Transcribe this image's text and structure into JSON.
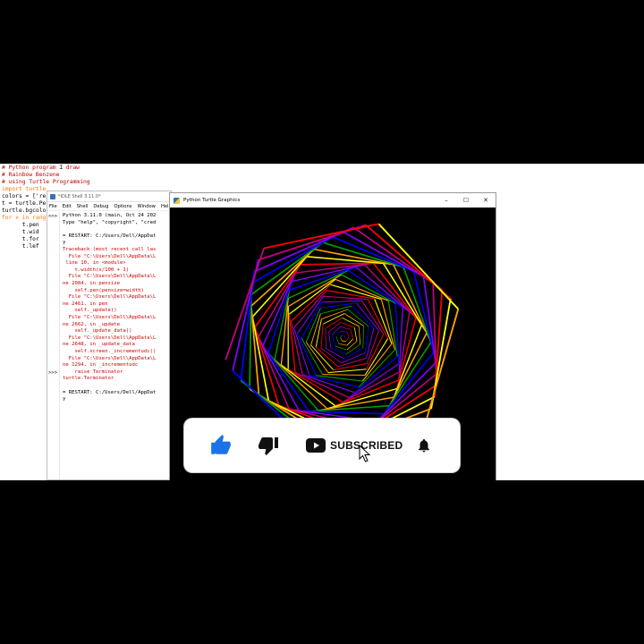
{
  "editor": {
    "lines": [
      {
        "text": "# Python program ",
        "tail": " draw",
        "cls": "c-comment"
      },
      {
        "text": "# Rainbow Benzene",
        "cls": "c-comment"
      },
      {
        "text": "# using Turtle Programming",
        "cls": "c-comment"
      },
      {
        "text": "import turtle",
        "cls": "c-kw"
      },
      {
        "text": "colors = ['re",
        "cls": ""
      },
      {
        "text": "t = turtle.Pe",
        "cls": ""
      },
      {
        "text": "turtle.bgcolo",
        "cls": ""
      },
      {
        "text": "for x in rang",
        "cls": "c-kw"
      },
      {
        "text": "      t.pen",
        "cls": ""
      },
      {
        "text": "      t.wid",
        "cls": ""
      },
      {
        "text": "      t.for",
        "cls": ""
      },
      {
        "text": "      t.lef",
        "cls": ""
      }
    ]
  },
  "idle": {
    "title": "*IDLE Shell 3.11.0*",
    "menus": [
      "File",
      "Edit",
      "Shell",
      "Debug",
      "Options",
      "Window",
      "Help"
    ],
    "prompts": [
      ">>>",
      ">>>"
    ],
    "lines": [
      {
        "text": "Python 3.11.0 (main, Oct 24 202",
        "cls": ""
      },
      {
        "text": "Type \"help\", \"copyright\", \"cred",
        "cls": ""
      },
      {
        "text": "",
        "cls": ""
      },
      {
        "text": "= RESTART: C:/Users/Dell/AppDat",
        "cls": ""
      },
      {
        "text": "y",
        "cls": ""
      },
      {
        "text": "Traceback (most recent call las",
        "cls": "s-red"
      },
      {
        "text": "  File \"C:\\Users\\Dell\\AppData\\L",
        "cls": "s-red"
      },
      {
        "text": " line 10, in <module>",
        "cls": "s-red"
      },
      {
        "text": "    t.width(x/100 + 1)",
        "cls": "s-red"
      },
      {
        "text": "  File \"C:\\Users\\Dell\\AppData\\L",
        "cls": "s-red"
      },
      {
        "text": "ne 2084, in pensize",
        "cls": "s-red"
      },
      {
        "text": "    self.pen(pensize=width)",
        "cls": "s-red"
      },
      {
        "text": "  File \"C:\\Users\\Dell\\AppData\\L",
        "cls": "s-red"
      },
      {
        "text": "ne 2461, in pen",
        "cls": "s-red"
      },
      {
        "text": "    self._update()",
        "cls": "s-red"
      },
      {
        "text": "  File \"C:\\Users\\Dell\\AppData\\L",
        "cls": "s-red"
      },
      {
        "text": "ne 2662, in _update",
        "cls": "s-red"
      },
      {
        "text": "    self._update_data()",
        "cls": "s-red"
      },
      {
        "text": "  File \"C:\\Users\\Dell\\AppData\\L",
        "cls": "s-red"
      },
      {
        "text": "ne 2648, in _update_data",
        "cls": "s-red"
      },
      {
        "text": "    self.screen._incrementudc()",
        "cls": "s-red"
      },
      {
        "text": "  File \"C:\\Users\\Dell\\AppData\\L",
        "cls": "s-red"
      },
      {
        "text": "ne 1294, in _incrementudc",
        "cls": "s-red"
      },
      {
        "text": "    raise Terminator",
        "cls": "s-red"
      },
      {
        "text": "turtle.Terminator",
        "cls": "s-red"
      },
      {
        "text": "",
        "cls": ""
      },
      {
        "text": "= RESTART: C:/Users/Dell/AppDat",
        "cls": ""
      },
      {
        "text": "y",
        "cls": ""
      }
    ]
  },
  "turtle_window": {
    "title": "Python Turtle Graphics",
    "controls": [
      "–",
      "☐",
      "✕"
    ],
    "rainbow_colors": [
      "#ff0000",
      "#c00080",
      "#8000ff",
      "#0000ff",
      "#00a000",
      "#ffa000",
      "#ffff00"
    ]
  },
  "overlay": {
    "like_icon": "thumbs-up-icon",
    "dislike_icon": "thumbs-down-icon",
    "channel_icon": "youtube-play-icon",
    "subscribe_label": "SUBSCRIBED",
    "bell_icon": "bell-icon",
    "like_color": "#1a73e8"
  }
}
